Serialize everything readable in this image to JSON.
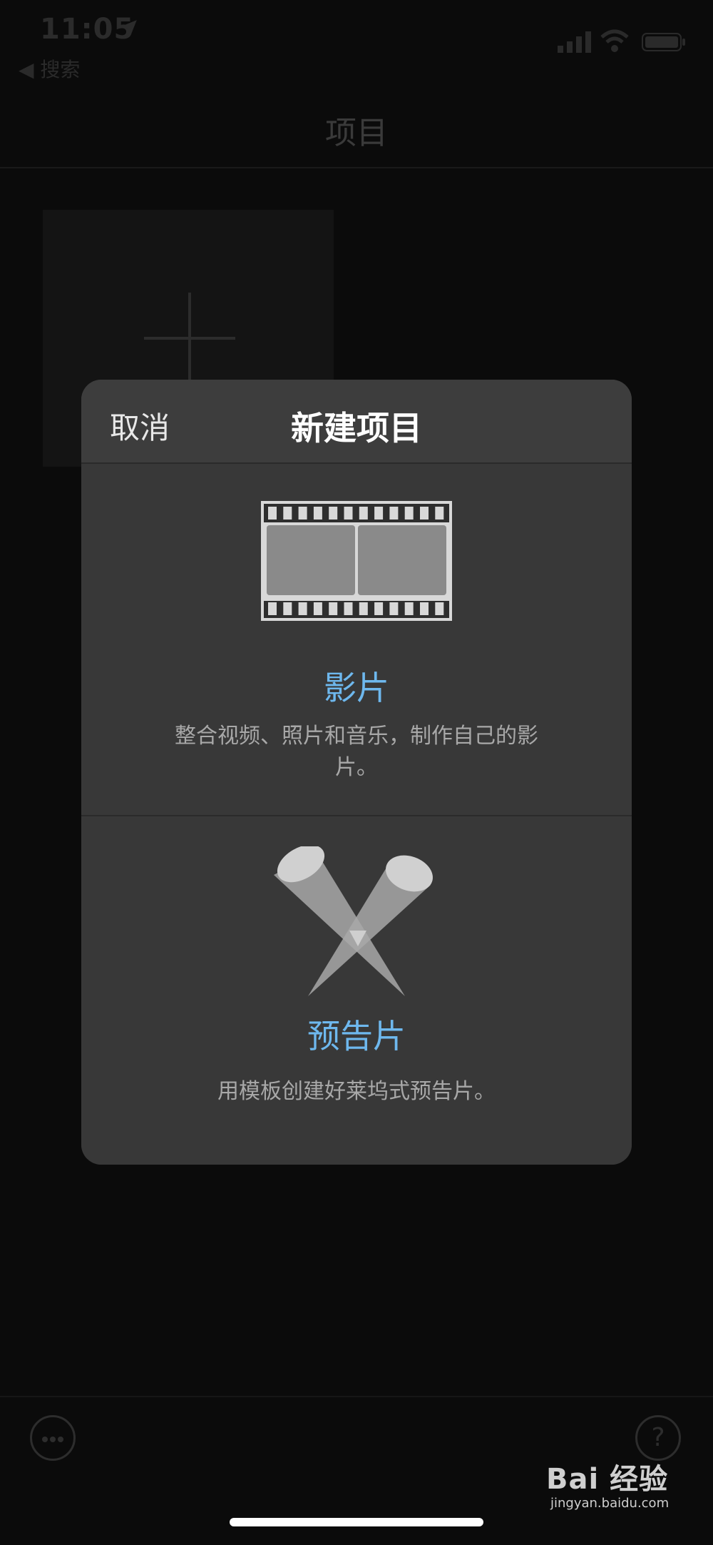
{
  "status_bar": {
    "time": "11:05",
    "back_label": "◀ 搜索"
  },
  "nav": {
    "title": "项目"
  },
  "modal": {
    "cancel_label": "取消",
    "title": "新建项目",
    "options": [
      {
        "icon": "film-strip-icon",
        "title": "影片",
        "description": "整合视频、照片和音乐，制作自己的影片。"
      },
      {
        "icon": "spotlights-icon",
        "title": "预告片",
        "description": "用模板创建好莱坞式预告片。"
      }
    ],
    "accent_color": "#6eb8ee"
  },
  "toolbar": {
    "help_label": "?"
  },
  "watermark": {
    "brand": "Bai 经验",
    "url": "jingyan.baidu.com"
  }
}
